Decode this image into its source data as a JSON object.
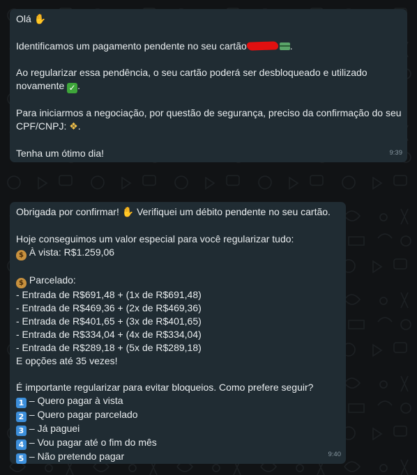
{
  "colors": {
    "background": "#111315",
    "bubble": "#202c33",
    "text": "#e9edef",
    "timestamp": "#8696a0",
    "redaction": "#e01010"
  },
  "messages": [
    {
      "lines": {
        "greeting": "Olá",
        "greeting_emoji": "wave-icon",
        "pending_text": "Identificamos um pagamento pendente no seu cartão",
        "pending_end": ".",
        "regularize_text": "Ao regularizar essa pendência, o seu cartão poderá ser desbloqueado e utilizado",
        "regularize_text_2": "novamente",
        "regularize_end": ".",
        "negotiation_text": "Para iniciarmos a negociação, por questão de segurança, preciso da confirmação do seu",
        "negotiation_text_2": "CPF/CNPJ:",
        "negotiation_end": ".",
        "closing": "Tenha um ótimo dia!"
      },
      "time": "9:39"
    },
    {
      "lines": {
        "thanks": "Obrigada por confirmar!",
        "thanks_2": "Verifiquei um débito pendente no seu cartão.",
        "offer": "Hoje conseguimos um valor especial para você regularizar tudo:",
        "cash": "À vista: R$1.259,06",
        "installments_title": "Parcelado:",
        "installments": [
          "- Entrada de R$691,48 + (1x de R$691,48)",
          "- Entrada de R$469,36 + (2x de R$469,36)",
          "- Entrada de R$401,65 + (3x de R$401,65)",
          "- Entrada de R$334,04 + (4x de R$334,04)",
          "- Entrada de R$289,18 + (5x de R$289,18)"
        ],
        "more_options": "E opções até 35 vezes!",
        "question": "É importante regularizar para evitar bloqueios. Como prefere seguir?",
        "options": [
          {
            "num": "1",
            "label": " – Quero pagar à vista"
          },
          {
            "num": "2",
            "label": " – Quero pagar parcelado"
          },
          {
            "num": "3",
            "label": " – Já paguei"
          },
          {
            "num": "4",
            "label": " – Vou pagar até o fim do mês"
          },
          {
            "num": "5",
            "label": " – Não pretendo pagar"
          }
        ]
      },
      "time": "9:40"
    }
  ]
}
